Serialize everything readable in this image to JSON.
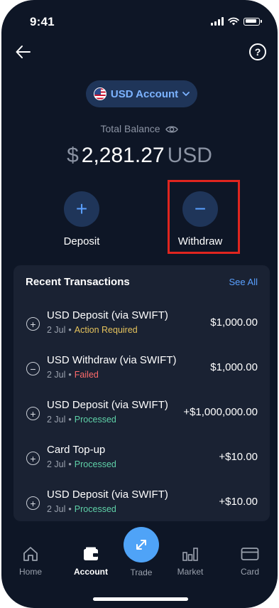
{
  "status_bar": {
    "time": "9:41"
  },
  "header": {
    "help_label": "?"
  },
  "account": {
    "label": "USD Account",
    "flag": "us-flag-icon"
  },
  "balance": {
    "label": "Total Balance",
    "symbol": "$",
    "amount": "2,281.27",
    "currency": "USD"
  },
  "actions": [
    {
      "label": "Deposit",
      "icon": "plus-icon",
      "glyph": "+"
    },
    {
      "label": "Withdraw",
      "icon": "minus-icon",
      "glyph": "−"
    }
  ],
  "transactions": {
    "title": "Recent Transactions",
    "see_all": "See All",
    "items": [
      {
        "icon": "+",
        "name": "USD Deposit (via SWIFT)",
        "date": "2 Jul",
        "status": "Action Required",
        "amount": "$1,000.00"
      },
      {
        "icon": "−",
        "name": "USD Withdraw (via SWIFT)",
        "date": "2 Jul",
        "status": "Failed",
        "amount": "$1,000.00"
      },
      {
        "icon": "+",
        "name": "USD Deposit (via SWIFT)",
        "date": "2 Jul",
        "status": "Processed",
        "amount": "+$1,000,000.00"
      },
      {
        "icon": "+",
        "name": "Card Top-up",
        "date": "2 Jul",
        "status": "Processed",
        "amount": "+$10.00"
      },
      {
        "icon": "+",
        "name": "USD Deposit (via SWIFT)",
        "date": "2 Jul",
        "status": "Processed",
        "amount": "+$10.00"
      }
    ]
  },
  "tabbar": {
    "items": [
      {
        "label": "Home",
        "icon": "home-icon",
        "active": false
      },
      {
        "label": "Account",
        "icon": "wallet-icon",
        "active": true
      },
      {
        "label": "Trade",
        "icon": "trade-arrows-icon",
        "active": false
      },
      {
        "label": "Market",
        "icon": "bar-chart-icon",
        "active": false
      },
      {
        "label": "Card",
        "icon": "card-icon",
        "active": false
      }
    ]
  },
  "colors": {
    "background": "#0e1626",
    "card": "#1a2233",
    "accent": "#5aa0ff",
    "action_required": "#e6c35c",
    "failed": "#ff6b6b",
    "processed": "#5fd1a8",
    "highlight": "#e0251f"
  }
}
